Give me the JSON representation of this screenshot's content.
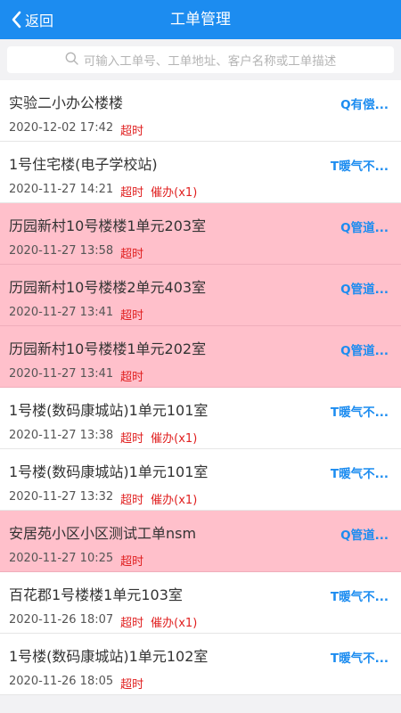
{
  "header": {
    "back_label": "返回",
    "title": "工单管理"
  },
  "search": {
    "placeholder": "可输入工单号、工单地址、客户名称或工单描述"
  },
  "items": [
    {
      "name": "实验二小办公楼楼",
      "time": "2020-12-02 17:42",
      "status": "超时",
      "urge": "",
      "tag": "Q有偿...",
      "highlight": false
    },
    {
      "name": "1号住宅楼(电子学校站)",
      "time": "2020-11-27 14:21",
      "status": "超时",
      "urge": "催办(x1)",
      "tag": "T暖气不...",
      "highlight": false
    },
    {
      "name": "历园新村10号楼楼1单元203室",
      "time": "2020-11-27 13:58",
      "status": "超时",
      "urge": "",
      "tag": "Q管道...",
      "highlight": true
    },
    {
      "name": "历园新村10号楼楼2单元403室",
      "time": "2020-11-27 13:41",
      "status": "超时",
      "urge": "",
      "tag": "Q管道...",
      "highlight": true
    },
    {
      "name": "历园新村10号楼楼1单元202室",
      "time": "2020-11-27 13:41",
      "status": "超时",
      "urge": "",
      "tag": "Q管道...",
      "highlight": true
    },
    {
      "name": "1号楼(数码康城站)1单元101室",
      "time": "2020-11-27 13:38",
      "status": "超时",
      "urge": "催办(x1)",
      "tag": "T暖气不...",
      "highlight": false
    },
    {
      "name": "1号楼(数码康城站)1单元101室",
      "time": "2020-11-27 13:32",
      "status": "超时",
      "urge": "催办(x1)",
      "tag": "T暖气不...",
      "highlight": false
    },
    {
      "name": "安居苑小区小区测试工单nsm",
      "time": "2020-11-27 10:25",
      "status": "超时",
      "urge": "",
      "tag": "Q管道...",
      "highlight": true
    },
    {
      "name": "百花郡1号楼楼1单元103室",
      "time": "2020-11-26 18:07",
      "status": "超时",
      "urge": "催办(x1)",
      "tag": "T暖气不...",
      "highlight": false
    },
    {
      "name": "1号楼(数码康城站)1单元102室",
      "time": "2020-11-26 18:05",
      "status": "超时",
      "urge": "",
      "tag": "T暖气不...",
      "highlight": false
    }
  ]
}
